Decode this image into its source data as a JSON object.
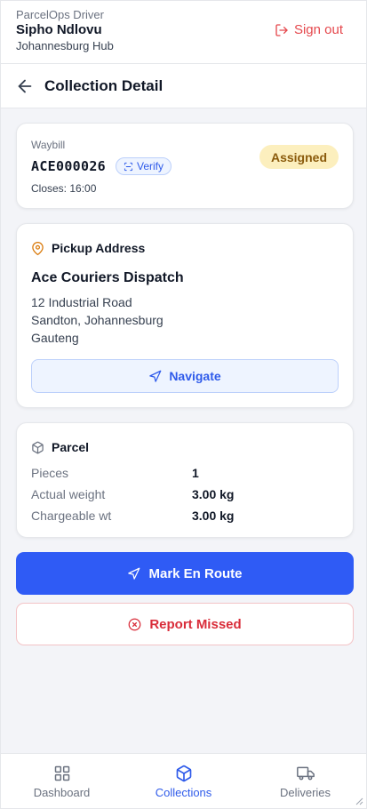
{
  "header": {
    "app_name": "ParcelOps Driver",
    "driver_name": "Sipho Ndlovu",
    "hub": "Johannesburg Hub",
    "sign_out_label": "Sign out"
  },
  "page": {
    "title": "Collection Detail"
  },
  "waybill_card": {
    "label": "Waybill",
    "number": "ACE000026",
    "verify_label": "Verify",
    "closes": "Closes: 16:00",
    "status": "Assigned"
  },
  "pickup_card": {
    "heading": "Pickup Address",
    "company": "Ace Couriers Dispatch",
    "address_lines": [
      "12 Industrial Road",
      "Sandton, Johannesburg",
      "Gauteng"
    ],
    "navigate_label": "Navigate"
  },
  "parcel_card": {
    "heading": "Parcel",
    "rows": [
      {
        "label": "Pieces",
        "value": "1"
      },
      {
        "label": "Actual weight",
        "value": "3.00 kg"
      },
      {
        "label": "Chargeable wt",
        "value": "3.00 kg"
      }
    ]
  },
  "actions": {
    "primary_label": "Mark En Route",
    "danger_label": "Report Missed"
  },
  "bottom_nav": {
    "items": [
      {
        "label": "Dashboard",
        "icon": "grid-icon"
      },
      {
        "label": "Collections",
        "icon": "box-icon",
        "active": true
      },
      {
        "label": "Deliveries",
        "icon": "truck-icon"
      }
    ]
  },
  "colors": {
    "accent": "#2f5bf5",
    "danger": "#d92d3a",
    "status_bg": "#fcefbe",
    "status_text": "#8a5a0b"
  }
}
